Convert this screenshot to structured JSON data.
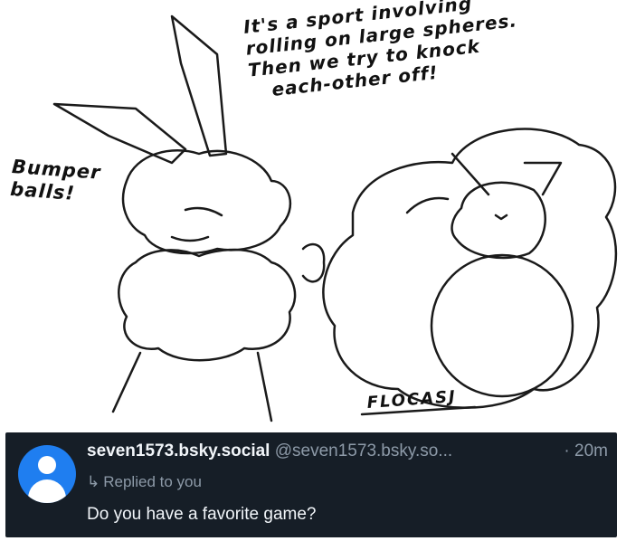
{
  "comic": {
    "speech_right": "It's a sport involving\nrolling on large spheres.\nThen we try to knock\n   each-other off!",
    "speech_left": "Bumper\nballs!",
    "signature": "FLOCASJ"
  },
  "reply": {
    "display_name": "seven1573.bsky.social",
    "handle": "@seven1573.bsky.so...",
    "time": "· 20m",
    "replied_label": "Replied to you",
    "text": "Do you have a favorite game?",
    "avatar_color": "#1f7ef0",
    "background_color": "#161e27"
  }
}
